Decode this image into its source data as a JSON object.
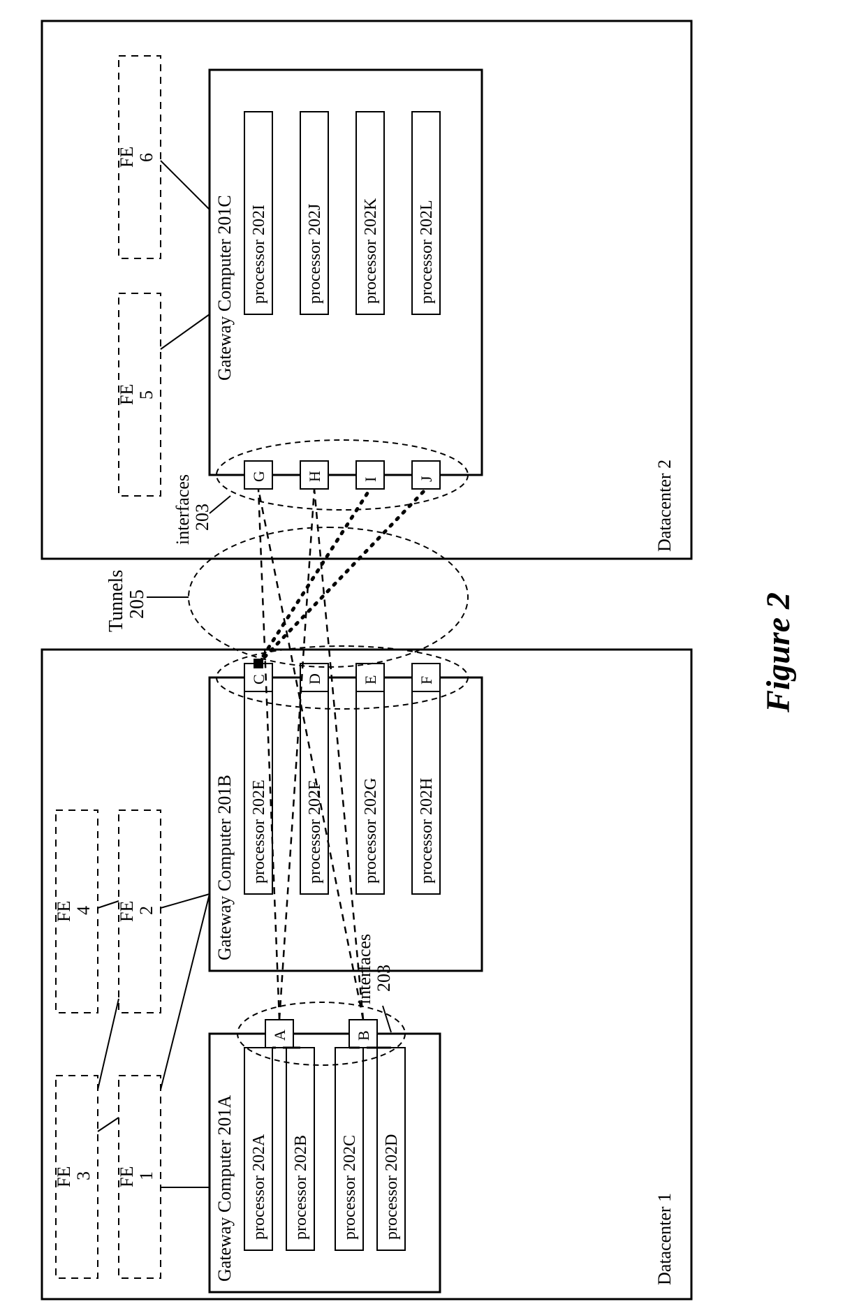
{
  "figure_label": "Figure 2",
  "dc1": {
    "label": "Datacenter 1",
    "fe": [
      "FE",
      "1",
      "FE",
      "2",
      "FE",
      "3",
      "FE",
      "4"
    ],
    "gwA": {
      "title": "Gateway Computer 201A",
      "procs": [
        "processor 202A",
        "processor 202B",
        "processor 202C",
        "processor 202D"
      ],
      "ifaces": [
        "A",
        "B"
      ]
    },
    "gwB": {
      "title": "Gateway Computer 201B",
      "procs": [
        "processor 202E",
        "processor 202F",
        "processor 202G",
        "processor 202H"
      ],
      "ifaces": [
        "C",
        "D",
        "E",
        "F"
      ]
    },
    "iface_label": [
      "interfaces",
      "203"
    ]
  },
  "dc2": {
    "label": "Datacenter 2",
    "fe": [
      "FE",
      "5",
      "FE",
      "6"
    ],
    "gwC": {
      "title": "Gateway Computer 201C",
      "procs": [
        "processor 202I",
        "processor 202J",
        "processor 202K",
        "processor 202L"
      ],
      "ifaces": [
        "G",
        "H",
        "I",
        "J"
      ]
    },
    "iface_label": [
      "interfaces",
      "203"
    ]
  },
  "tunnels": [
    "Tunnels",
    "205"
  ]
}
